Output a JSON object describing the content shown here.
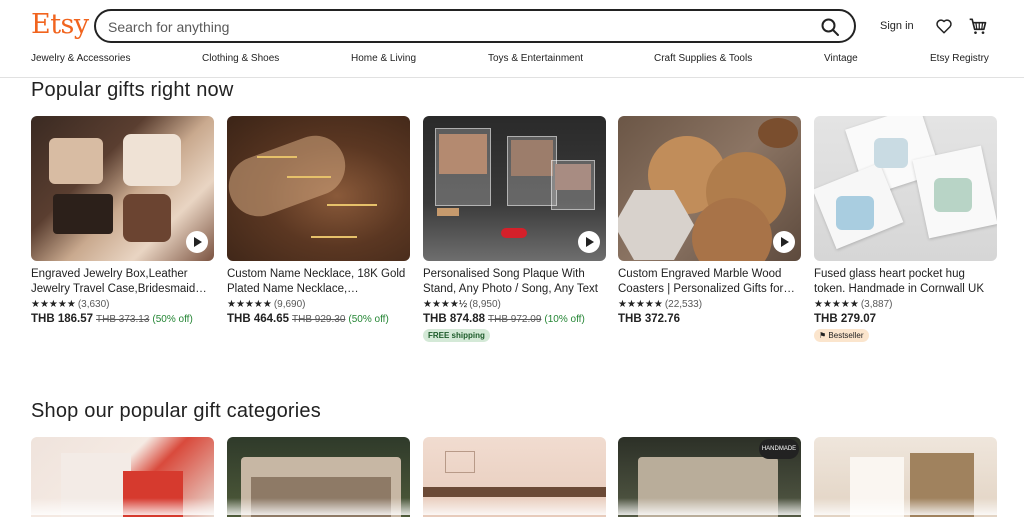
{
  "header": {
    "logo": "Etsy",
    "search_placeholder": "Search for anything",
    "signin_label": "Sign in",
    "icons": [
      "search-icon",
      "heart-icon",
      "cart-icon"
    ]
  },
  "nav": [
    "Jewelry & Accessories",
    "Clothing & Shoes",
    "Home & Living",
    "Toys & Entertainment",
    "Craft Supplies & Tools",
    "Vintage",
    "Etsy Registry"
  ],
  "popular": {
    "title": "Popular gifts right now",
    "items": [
      {
        "title": "Engraved Jewelry Box,Leather Jewelry Travel Case,Bridesmaid Gift",
        "stars": "★★★★★",
        "rating_count": "(3,630)",
        "price": "THB 186.57",
        "original_price": "THB 373.13",
        "discount": "(50% off)",
        "video": true
      },
      {
        "title": "Custom Name Necklace, 18K Gold Plated Name Necklace, Personalized",
        "stars": "★★★★★",
        "rating_count": "(9,690)",
        "price": "THB 464.65",
        "original_price": "THB 929.30",
        "discount": "(50% off)",
        "video": false
      },
      {
        "title": "Personalised Song Plaque With Stand, Any Photo / Song, Any Text",
        "stars": "★★★★½",
        "rating_count": "(8,950)",
        "price": "THB 874.88",
        "original_price": "THB 972.09",
        "discount": "(10% off)",
        "badge": "FREE shipping",
        "video": true
      },
      {
        "title": "Custom Engraved Marble Wood Coasters | Personalized Gifts for Home",
        "stars": "★★★★★",
        "rating_count": "(22,533)",
        "price": "THB 372.76",
        "video": true
      },
      {
        "title": "Fused glass heart pocket hug token. Handmade in Cornwall UK",
        "stars": "★★★★★",
        "rating_count": "(3,887)",
        "price": "THB 279.07",
        "badge": "Bestseller",
        "video": false
      }
    ]
  },
  "categories": {
    "title": "Shop our popular gift categories",
    "handmade_badge": "HANDMADE"
  },
  "colors": {
    "brand": "#f1641e",
    "discount": "#258635",
    "free_shipping_bg": "#d4e9d7",
    "bestseller_bg": "#fbe5cd"
  }
}
